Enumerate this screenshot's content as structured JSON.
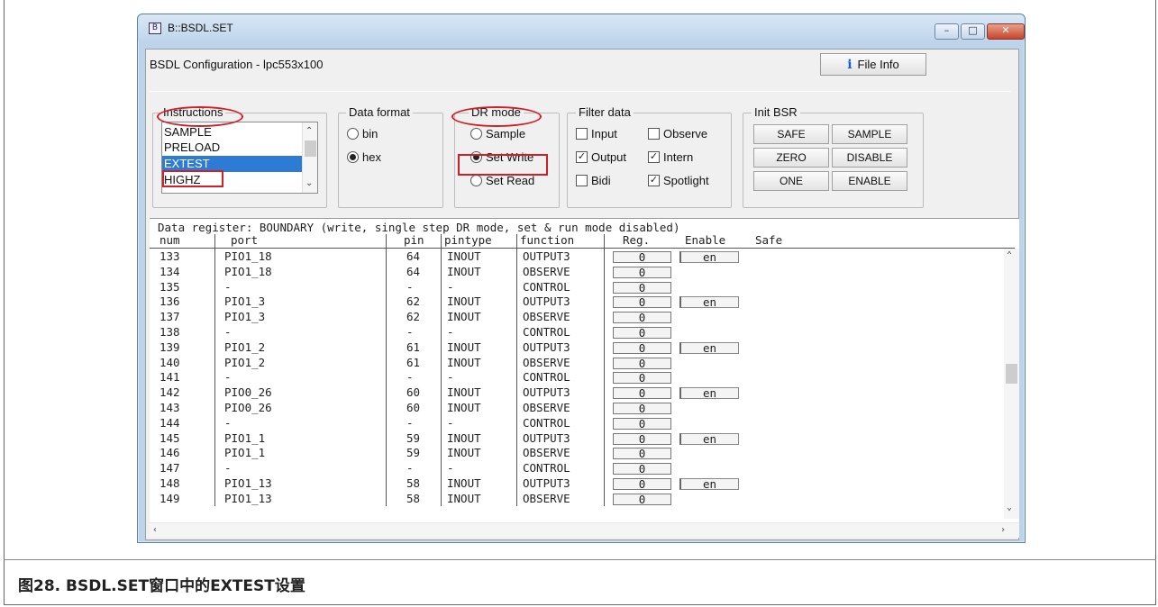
{
  "window": {
    "title": "B::BSDL.SET"
  },
  "header": {
    "config_label": "BSDL Configuration -  lpc553x100",
    "file_info": "File Info"
  },
  "instructions": {
    "legend": "Instructions",
    "items": [
      "SAMPLE",
      "PRELOAD",
      "EXTEST",
      "HIGHZ"
    ],
    "selected": "EXTEST"
  },
  "data_format": {
    "legend": "Data format",
    "options": [
      "bin",
      "hex"
    ],
    "selected": "hex"
  },
  "dr_mode": {
    "legend": "DR mode",
    "options": [
      "Sample",
      "Set Write",
      "Set Read"
    ],
    "selected": "Set Write"
  },
  "filter_data": {
    "legend": "Filter data",
    "items": [
      {
        "label": "Input",
        "checked": false
      },
      {
        "label": "Observe",
        "checked": false
      },
      {
        "label": "Output",
        "checked": true
      },
      {
        "label": "Intern",
        "checked": true
      },
      {
        "label": "Bidi",
        "checked": false
      },
      {
        "label": "Spotlight",
        "checked": true
      }
    ]
  },
  "init_bsr": {
    "legend": "Init BSR",
    "buttons": [
      "SAFE",
      "SAMPLE",
      "ZERO",
      "DISABLE",
      "ONE",
      "ENABLE"
    ]
  },
  "register": {
    "title": "Data register: BOUNDARY (write, single step DR mode, set & run mode disabled)",
    "headers": {
      "num": "num",
      "port": "port",
      "pin": "pin",
      "pintype": "pintype",
      "function": "function",
      "reg": "Reg.",
      "enable": "Enable",
      "safe": "Safe"
    },
    "rows": [
      {
        "num": "133",
        "port": "PIO1_18",
        "pin": "64",
        "pintype": "INOUT",
        "function": "OUTPUT3",
        "reg": "0",
        "enable": "en"
      },
      {
        "num": "134",
        "port": "PIO1_18",
        "pin": "64",
        "pintype": "INOUT",
        "function": "OBSERVE",
        "reg": "0",
        "enable": ""
      },
      {
        "num": "135",
        "port": "-",
        "pin": "-",
        "pintype": "-",
        "function": "CONTROL",
        "reg": "0",
        "enable": ""
      },
      {
        "num": "136",
        "port": "PIO1_3",
        "pin": "62",
        "pintype": "INOUT",
        "function": "OUTPUT3",
        "reg": "0",
        "enable": "en"
      },
      {
        "num": "137",
        "port": "PIO1_3",
        "pin": "62",
        "pintype": "INOUT",
        "function": "OBSERVE",
        "reg": "0",
        "enable": ""
      },
      {
        "num": "138",
        "port": "-",
        "pin": "-",
        "pintype": "-",
        "function": "CONTROL",
        "reg": "0",
        "enable": ""
      },
      {
        "num": "139",
        "port": "PIO1_2",
        "pin": "61",
        "pintype": "INOUT",
        "function": "OUTPUT3",
        "reg": "0",
        "enable": "en"
      },
      {
        "num": "140",
        "port": "PIO1_2",
        "pin": "61",
        "pintype": "INOUT",
        "function": "OBSERVE",
        "reg": "0",
        "enable": ""
      },
      {
        "num": "141",
        "port": "-",
        "pin": "-",
        "pintype": "-",
        "function": "CONTROL",
        "reg": "0",
        "enable": ""
      },
      {
        "num": "142",
        "port": "PIO0_26",
        "pin": "60",
        "pintype": "INOUT",
        "function": "OUTPUT3",
        "reg": "0",
        "enable": "en"
      },
      {
        "num": "143",
        "port": "PIO0_26",
        "pin": "60",
        "pintype": "INOUT",
        "function": "OBSERVE",
        "reg": "0",
        "enable": ""
      },
      {
        "num": "144",
        "port": "-",
        "pin": "-",
        "pintype": "-",
        "function": "CONTROL",
        "reg": "0",
        "enable": ""
      },
      {
        "num": "145",
        "port": "PIO1_1",
        "pin": "59",
        "pintype": "INOUT",
        "function": "OUTPUT3",
        "reg": "0",
        "enable": "en"
      },
      {
        "num": "146",
        "port": "PIO1_1",
        "pin": "59",
        "pintype": "INOUT",
        "function": "OBSERVE",
        "reg": "0",
        "enable": ""
      },
      {
        "num": "147",
        "port": "-",
        "pin": "-",
        "pintype": "-",
        "function": "CONTROL",
        "reg": "0",
        "enable": ""
      },
      {
        "num": "148",
        "port": "PIO1_13",
        "pin": "58",
        "pintype": "INOUT",
        "function": "OUTPUT3",
        "reg": "0",
        "enable": "en"
      },
      {
        "num": "149",
        "port": "PIO1_13",
        "pin": "58",
        "pintype": "INOUT",
        "function": "OBSERVE",
        "reg": "0",
        "enable": ""
      }
    ]
  },
  "caption": "图28. BSDL.SET窗口中的EXTEST设置",
  "colors": {
    "highlight": "#d11f2a",
    "selection": "#2e7bd6"
  }
}
